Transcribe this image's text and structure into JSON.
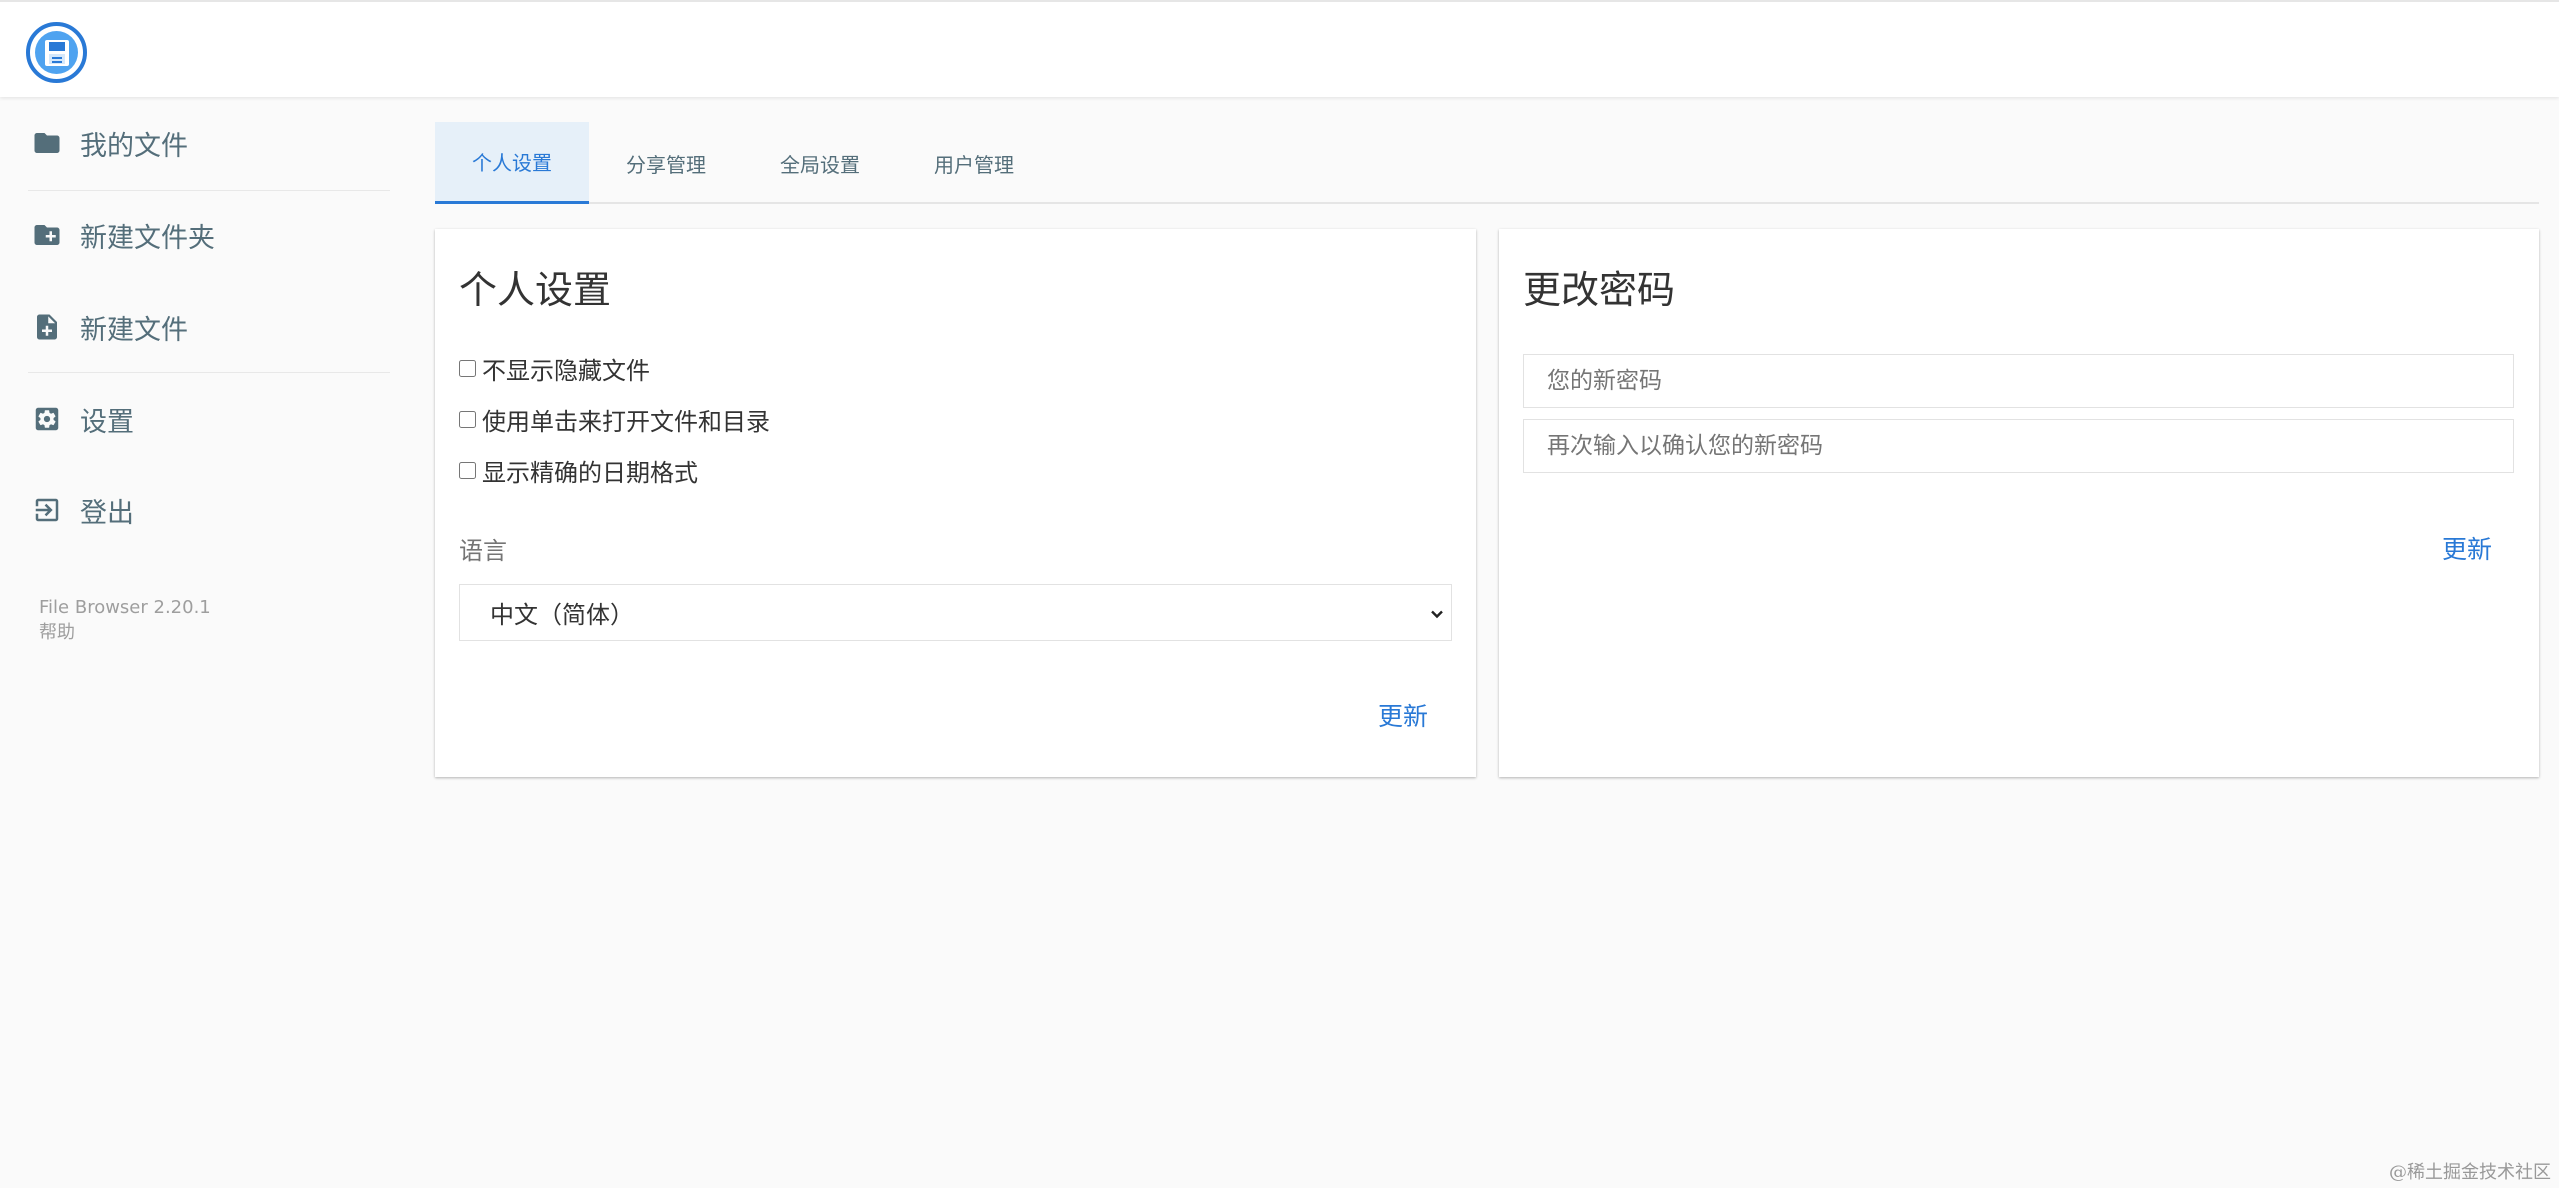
{
  "sidebar": {
    "items": [
      {
        "label": "我的文件",
        "icon": "folder-icon"
      },
      {
        "label": "新建文件夹",
        "icon": "create-folder-icon"
      },
      {
        "label": "新建文件",
        "icon": "note-add-icon"
      },
      {
        "label": "设置",
        "icon": "settings-icon"
      },
      {
        "label": "登出",
        "icon": "exit-icon"
      }
    ],
    "version": "File Browser 2.20.1",
    "help": "帮助"
  },
  "tabs": [
    {
      "label": "个人设置",
      "active": true
    },
    {
      "label": "分享管理",
      "active": false
    },
    {
      "label": "全局设置",
      "active": false
    },
    {
      "label": "用户管理",
      "active": false
    }
  ],
  "profile": {
    "title": "个人设置",
    "options": [
      {
        "label": "不显示隐藏文件",
        "checked": false
      },
      {
        "label": "使用单击来打开文件和目录",
        "checked": false
      },
      {
        "label": "显示精确的日期格式",
        "checked": false
      }
    ],
    "language_label": "语言",
    "language_value": "中文（简体）",
    "update_label": "更新"
  },
  "password": {
    "title": "更改密码",
    "new_placeholder": "您的新密码",
    "confirm_placeholder": "再次输入以确认您的新密码",
    "update_label": "更新"
  },
  "watermark": "@稀土掘金技术社区",
  "colors": {
    "accent": "#2979d6",
    "icon": "#546e7a"
  }
}
